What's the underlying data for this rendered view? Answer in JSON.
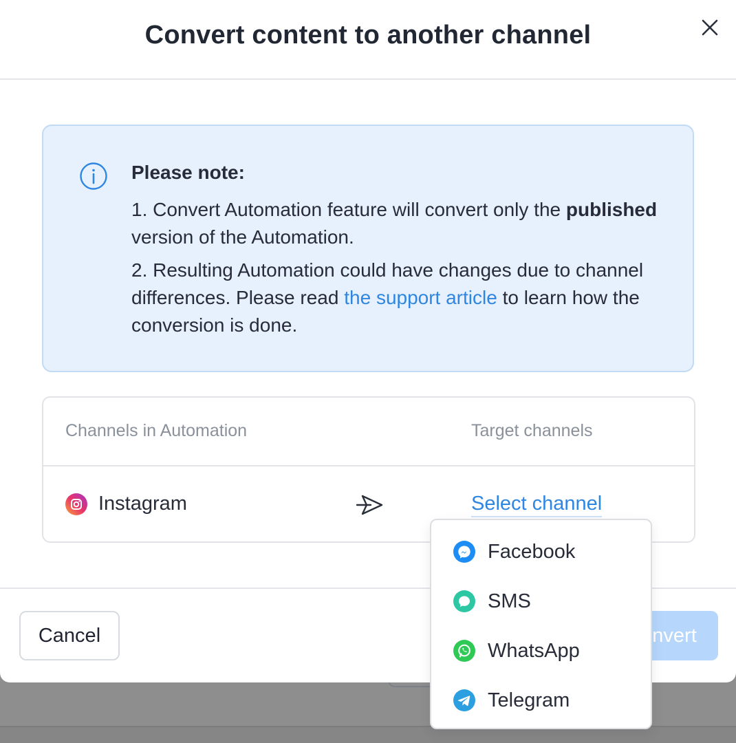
{
  "modal": {
    "title": "Convert content to another channel"
  },
  "note": {
    "title": "Please note:",
    "line1_prefix": "1. Convert Automation feature will convert only the ",
    "line1_bold": "published",
    "line1_suffix": " version of the Automation.",
    "line2_prefix": "2. Resulting Automation could have changes due to channel differences. Please read ",
    "line2_link": "the support article",
    "line2_suffix": " to learn how the conversion is done."
  },
  "mapping": {
    "col_source": "Channels in Automation",
    "col_target": "Target channels",
    "source_channel": "Instagram",
    "target_placeholder": "Select channel"
  },
  "dropdown": {
    "options": [
      {
        "label": "Facebook",
        "icon": "messenger-icon",
        "color": "#1e8cf5"
      },
      {
        "label": "SMS",
        "icon": "sms-icon",
        "color": "#2ec7a4"
      },
      {
        "label": "WhatsApp",
        "icon": "whatsapp-icon",
        "color": "#2fc955"
      },
      {
        "label": "Telegram",
        "icon": "telegram-icon",
        "color": "#2b9fe0"
      }
    ]
  },
  "footer": {
    "cancel_label": "Cancel",
    "convert_label": "Convert"
  },
  "colors": {
    "accent": "#2f86e0",
    "note_bg": "#e7f1fd",
    "convert_disabled": "#b6d6fb"
  }
}
